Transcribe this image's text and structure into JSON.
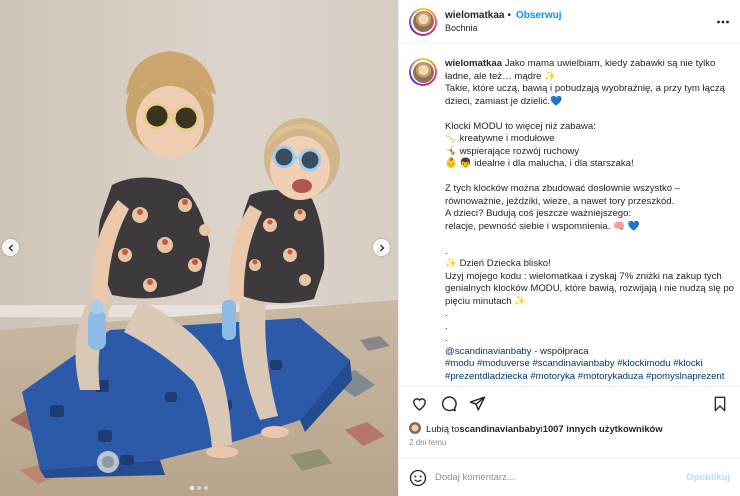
{
  "post": {
    "username": "wielomatkaa",
    "follow_label": "Obserwuj",
    "separator": "•",
    "location": "Bochnia",
    "more_icon": "more-horizontal-icon"
  },
  "caption": {
    "author": "wielomatkaa",
    "first_line": "Jako mama uwielbiam, kiedy zabawki są nie tylko",
    "lines": [
      "ładne, ale też… mądre ✨",
      "Takie, które uczą, bawią i pobudzają wyobraźnię, a przy tym łączą",
      "dzieci, zamiast je dzielić.💙",
      "",
      "Klocki MODU to więcej niż zabawa:",
      "🦴 kreatywne i modułowe",
      "🤸 wspierające rozwój ruchowy",
      "👶 👦 idealne i dla malucha, i dla starszaka!",
      "",
      "Z tych klocków można zbudować dosłownie wszystko –",
      "równoważnie, jeździki, wieże, a nawet tory przeszkód.",
      "A dzieci? Budują coś jeszcze ważniejszego:",
      "relacje, pewność siebie i wspomnienia. 🧠 💙",
      "",
      ".",
      "✨ Dzień Dziecka blisko!",
      "Użyj mojego kodu : wielomatkaa i zyskaj 7% zniżki na zakup tych",
      "genialnych klocków MODU, które bawią, rozwijają i nie nudzą się po",
      "pięciu minutach ✨",
      ".",
      ".",
      "."
    ],
    "collab_mention": "@scandinavianbaby",
    "collab_suffix": " - współpraca",
    "hashtags_line1": "#modu #moduverse #scandinavianbaby #klockimodu #klocki",
    "hashtags_line2": "#prezentdladziecka #motoryka #motorykaduza #pomyslnaprezent"
  },
  "actions": {
    "like_icon": "heart-icon",
    "comment_icon": "comment-icon",
    "share_icon": "send-icon",
    "save_icon": "bookmark-icon"
  },
  "likes": {
    "prefix": "Lubią to ",
    "user": "scandinavianbaby",
    "middle": " i ",
    "count": "1007 innych użytkowników"
  },
  "timestamp": "2 dni temu",
  "comment": {
    "placeholder": "Dodaj komentarz...",
    "publish_label": "Opublikuj"
  },
  "carousel": {
    "slides": 3,
    "active_slide": 1
  },
  "colors": {
    "link": "#0095f6",
    "mention": "#00376b",
    "publish_disabled": "#b3dbff",
    "muted": "#8e8e8e"
  }
}
